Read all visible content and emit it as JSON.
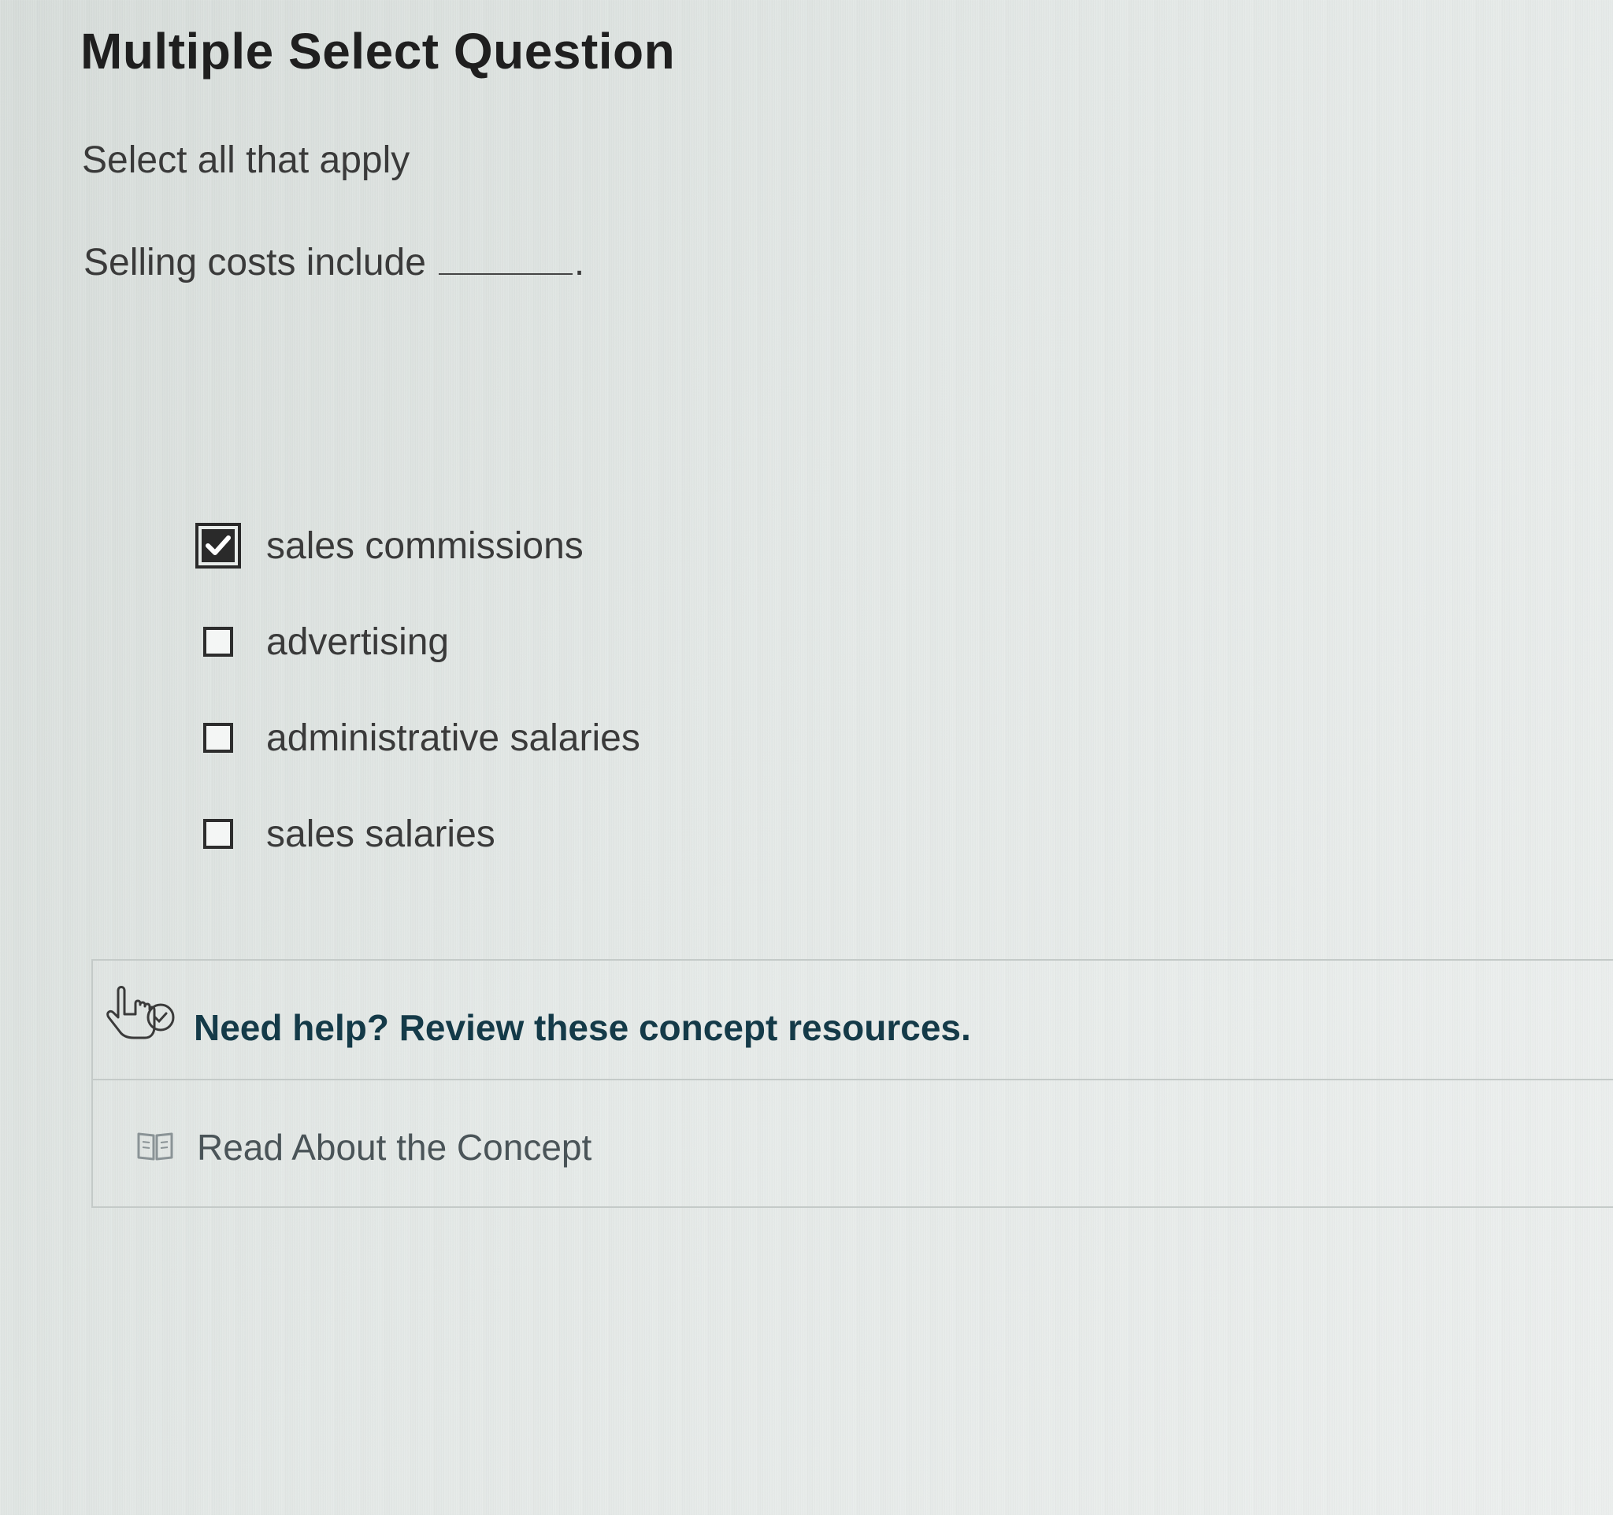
{
  "question": {
    "title": "Multiple Select Question",
    "instruction": "Select all that apply",
    "prompt": "Selling costs include",
    "prompt_end": "."
  },
  "options": [
    {
      "label": "sales commissions",
      "checked": true
    },
    {
      "label": "advertising",
      "checked": false
    },
    {
      "label": "administrative salaries",
      "checked": false
    },
    {
      "label": "sales salaries",
      "checked": false
    }
  ],
  "help": {
    "header": "Need help? Review these concept resources.",
    "icon": "pointing-hand-icon",
    "resources": [
      {
        "label": "Read About the Concept",
        "icon": "book-icon"
      }
    ]
  },
  "colors": {
    "help_text": "#143a48",
    "checkbox": "#2a2a2a"
  }
}
